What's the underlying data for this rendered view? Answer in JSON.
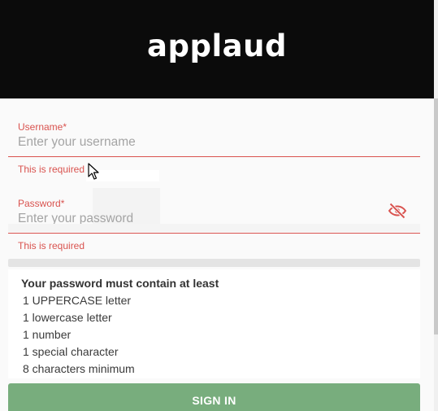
{
  "header": {
    "logo_text": "applaud"
  },
  "form": {
    "username": {
      "label": "Username*",
      "placeholder": "Enter your username",
      "value": "",
      "error": "This is required"
    },
    "password": {
      "label": "Password*",
      "placeholder": "Enter your password",
      "value": "",
      "error": "This is required",
      "visibility_icon": "eye-off-icon"
    },
    "password_rules": {
      "title": "Your password must contain at least",
      "items": [
        "1 UPPERCASE letter",
        "1 lowercase letter",
        "1 number",
        "1 special character",
        "8 characters minimum"
      ]
    },
    "sign_in_label": "SIGN IN"
  },
  "colors": {
    "header_bg": "#0b0b0b",
    "error": "#d9534f",
    "button_bg": "#78ad7d"
  }
}
